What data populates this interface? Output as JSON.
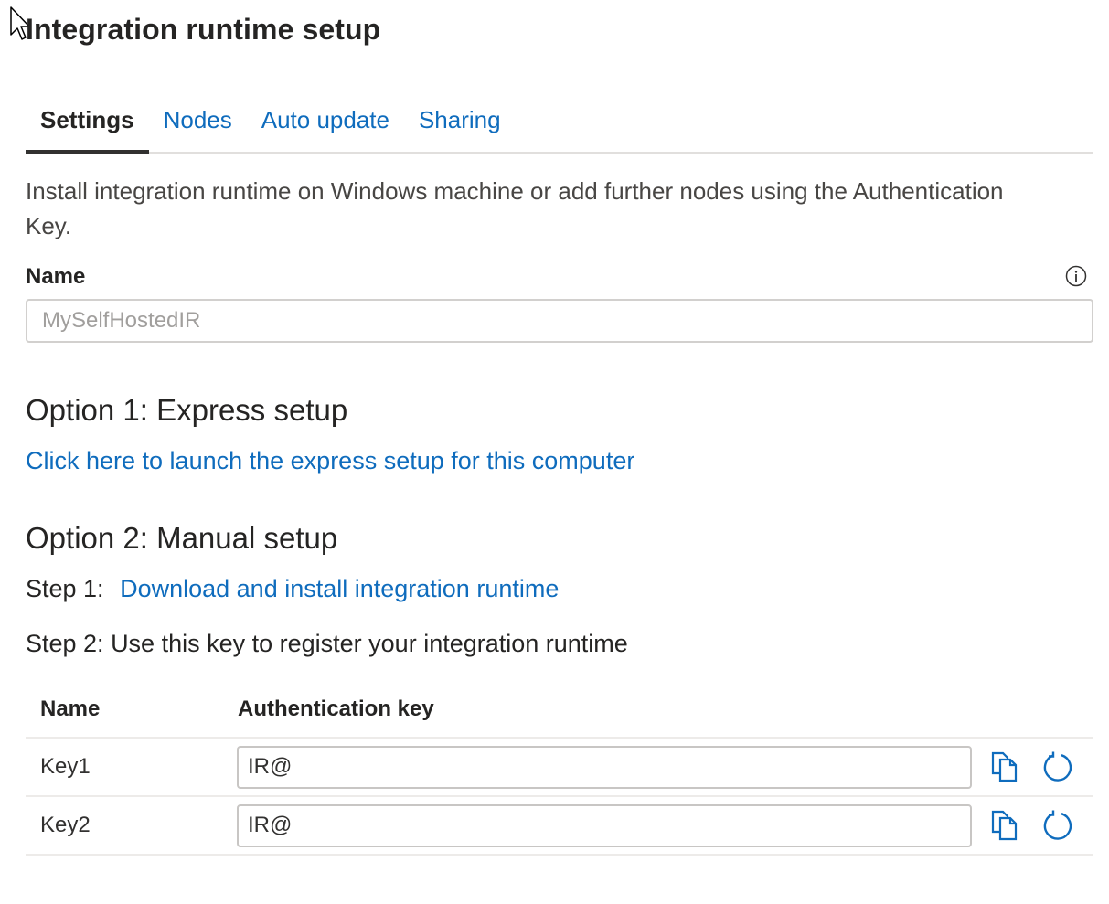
{
  "page": {
    "title": "Integration runtime setup"
  },
  "tabs": [
    {
      "label": "Settings",
      "active": true
    },
    {
      "label": "Nodes",
      "active": false
    },
    {
      "label": "Auto update",
      "active": false
    },
    {
      "label": "Sharing",
      "active": false
    }
  ],
  "settings": {
    "description": "Install integration runtime on Windows machine or add further nodes using the Authentication Key.",
    "name_field": {
      "label": "Name",
      "value": "",
      "placeholder": "MySelfHostedIR",
      "info_icon": "info-icon"
    },
    "option1": {
      "heading": "Option 1: Express setup",
      "link_label": "Click here to launch the express setup for this computer"
    },
    "option2": {
      "heading": "Option 2: Manual setup",
      "step1_prefix": "Step 1:",
      "step1_link": "Download and install integration runtime",
      "step2_text": "Step 2: Use this key to register your integration runtime"
    },
    "keys_table": {
      "columns": [
        "Name",
        "Authentication key"
      ],
      "rows": [
        {
          "name": "Key1",
          "key_value": "IR@",
          "copy_icon": "copy-icon",
          "regenerate_icon": "refresh-icon"
        },
        {
          "name": "Key2",
          "key_value": "IR@",
          "copy_icon": "copy-icon",
          "regenerate_icon": "refresh-icon"
        }
      ]
    }
  },
  "colors": {
    "accent": "#0f6cbd",
    "text_primary": "#252423",
    "border": "#d2d0ce"
  }
}
